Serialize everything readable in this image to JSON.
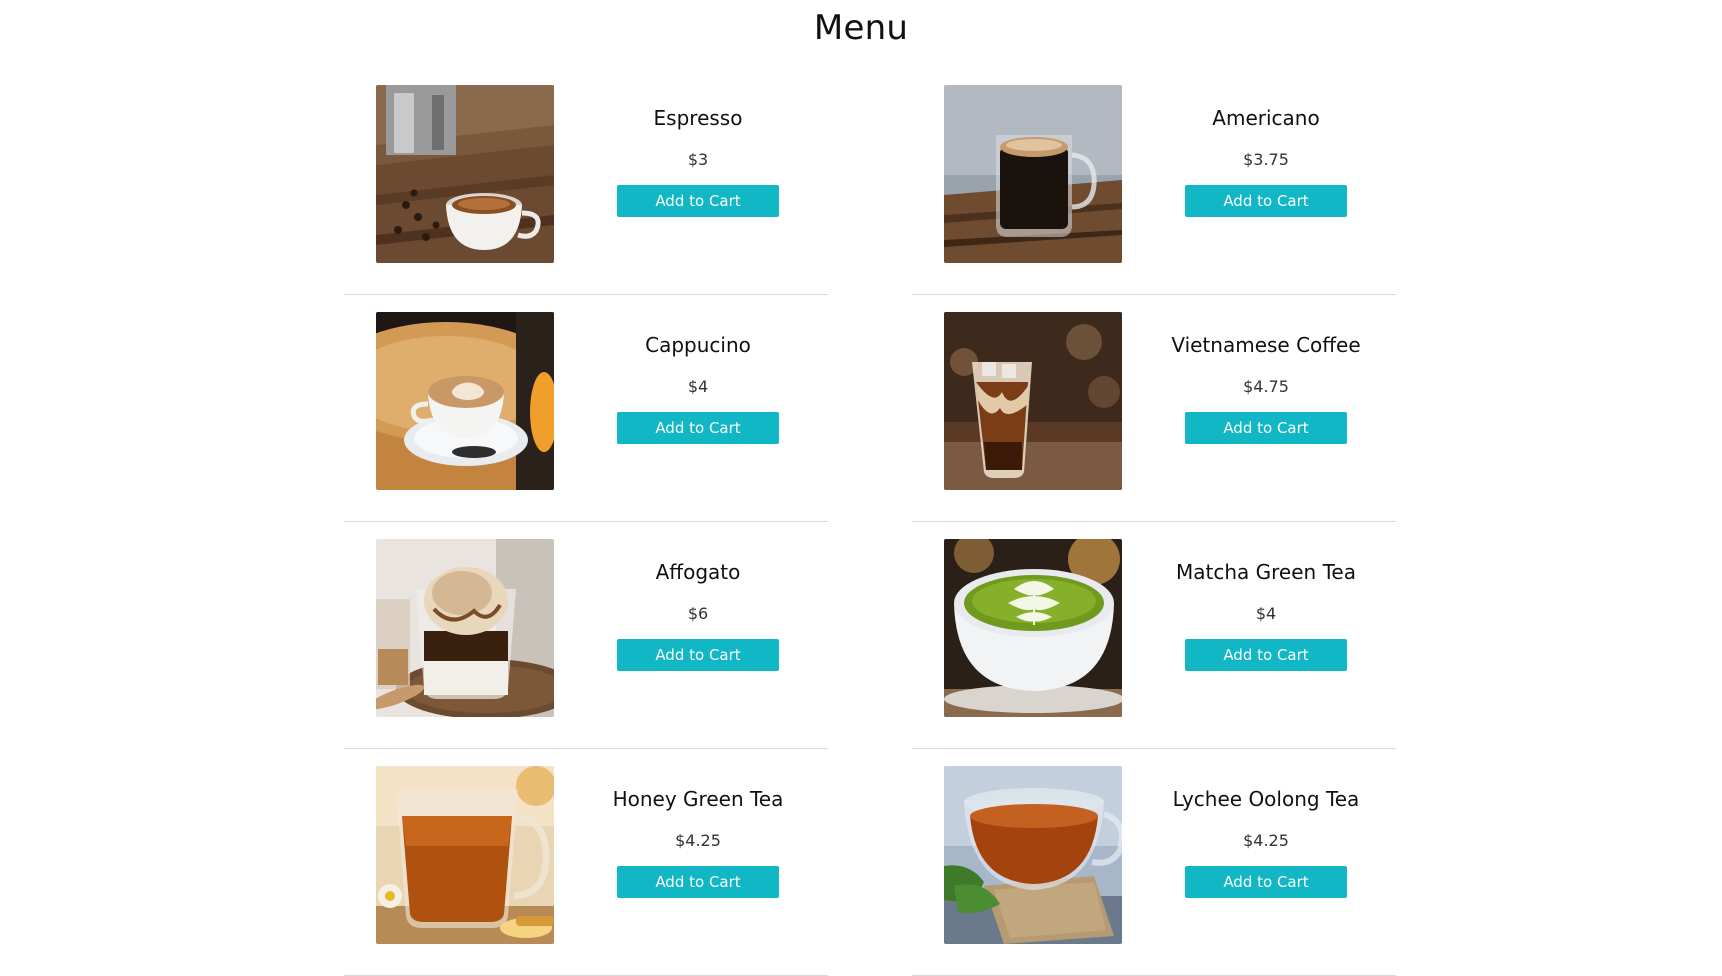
{
  "page": {
    "title": "Menu"
  },
  "theme": {
    "button_color": "#11b7c4",
    "divider_color": "#d8d8d8"
  },
  "items": [
    {
      "name": "Espresso",
      "price": "$3",
      "button_label": "Add to Cart",
      "image": "espresso-photo"
    },
    {
      "name": "Americano",
      "price": "$3.75",
      "button_label": "Add to Cart",
      "image": "americano-photo"
    },
    {
      "name": "Cappucino",
      "price": "$4",
      "button_label": "Add to Cart",
      "image": "cappuccino-photo"
    },
    {
      "name": "Vietnamese Coffee",
      "price": "$4.75",
      "button_label": "Add to Cart",
      "image": "vietnamese-coffee-photo"
    },
    {
      "name": "Affogato",
      "price": "$6",
      "button_label": "Add to Cart",
      "image": "affogato-photo"
    },
    {
      "name": "Matcha Green Tea",
      "price": "$4",
      "button_label": "Add to Cart",
      "image": "matcha-photo"
    },
    {
      "name": "Honey Green Tea",
      "price": "$4.25",
      "button_label": "Add to Cart",
      "image": "honey-green-tea-photo"
    },
    {
      "name": "Lychee Oolong Tea",
      "price": "$4.25",
      "button_label": "Add to Cart",
      "image": "lychee-oolong-tea-photo"
    }
  ]
}
